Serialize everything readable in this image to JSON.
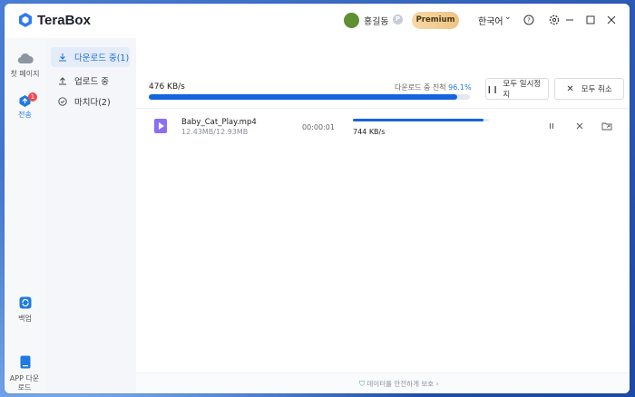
{
  "app": {
    "name": "TeraBox"
  },
  "header": {
    "username": "홍길동",
    "p_badge": "P",
    "premium_label": "Premium",
    "language": "한국어"
  },
  "sidebar": {
    "items": [
      {
        "label": "첫 페이지",
        "icon": "cloud-icon"
      },
      {
        "label": "전송",
        "icon": "transfer-icon",
        "badge": "1"
      },
      {
        "label": "백업",
        "icon": "backup-icon"
      },
      {
        "label": "APP 다운로드",
        "icon": "phone-icon"
      }
    ]
  },
  "subnav": {
    "items": [
      {
        "label": "다운로드 중(1)",
        "icon": "download-icon"
      },
      {
        "label": "업로드 중",
        "icon": "upload-icon"
      },
      {
        "label": "마치다(2)",
        "icon": "check-circle-icon"
      }
    ]
  },
  "summary": {
    "speed": "476 KB/s",
    "progress_label": "다운로드 중 진척",
    "progress_value": "96.1%",
    "progress_fraction": 0.961,
    "pause_all": "모두 일시정지",
    "cancel_all": "모두 취소"
  },
  "downloads": [
    {
      "name": "Baby_Cat_Play.mp4",
      "size": "12.43MB/12.93MB",
      "eta": "00:00:01",
      "speed": "744 KB/s",
      "progress_fraction": 0.961
    }
  ],
  "footer": {
    "text": "데이터를 안전하게 보호"
  },
  "colors": {
    "accent": "#1464e0",
    "premium": "#edc383",
    "badge": "#f5494d"
  }
}
